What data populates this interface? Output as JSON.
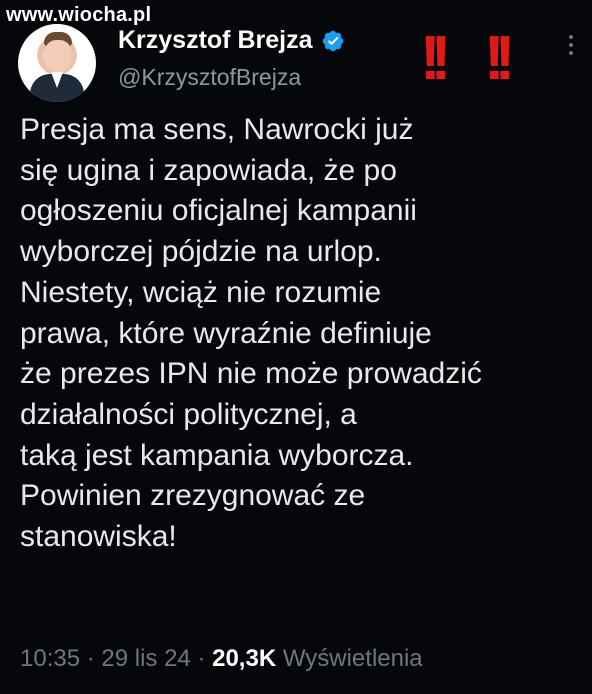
{
  "watermark": "www.wiocha.pl",
  "author": {
    "name": "Krzysztof Brejza",
    "handle": "@KrzysztofBrejza"
  },
  "decoration": {
    "alert_marks": [
      "!!",
      "!!"
    ],
    "alert_color": "#e11919"
  },
  "tweet": {
    "lines": [
      "Presja ma sens, Nawrocki już",
      "się ugina i zapowiada, że po",
      "ogłoszeniu oficjalnej kampanii",
      "wyborczej pójdzie na urlop.",
      "Niestety, wciąż nie rozumie",
      "prawa, które wyraźnie definiuje",
      "że prezes IPN nie może prowadzić",
      "działalności politycznej, a",
      "taką jest kampania wyborcza.",
      "Powinien zrezygnować ze",
      "stanowiska!"
    ]
  },
  "meta": {
    "time": "10:35",
    "sep1": " · ",
    "date": "29 lis 24",
    "sep2": " · ",
    "views_count": "20,3K",
    "views_label": " Wyświetlenia"
  },
  "colors": {
    "background": "#05070a",
    "text": "#e7e9ea",
    "muted": "#71767b",
    "verified": "#1d9bf0"
  },
  "icons": {
    "verified": "verified-badge-icon",
    "more": "more-options-icon"
  }
}
